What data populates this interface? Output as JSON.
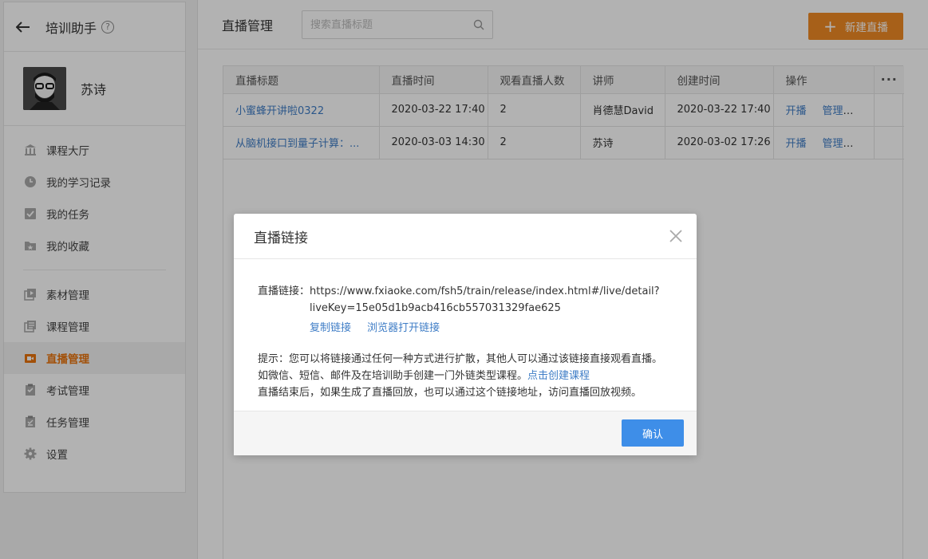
{
  "sidebar": {
    "title": "培训助手",
    "help_glyph": "?",
    "back_glyph": "←",
    "user_name": "苏诗",
    "nav_groups": [
      [
        {
          "label": "课程大厅",
          "icon": "bank-icon"
        },
        {
          "label": "我的学习记录",
          "icon": "clock-icon"
        },
        {
          "label": "我的任务",
          "icon": "checkbox-icon"
        },
        {
          "label": "我的收藏",
          "icon": "folder-star-icon"
        }
      ],
      [
        {
          "label": "素材管理",
          "icon": "media-icon"
        },
        {
          "label": "课程管理",
          "icon": "course-icon"
        },
        {
          "label": "直播管理",
          "icon": "live-camera-icon",
          "active": true
        },
        {
          "label": "考试管理",
          "icon": "exam-icon"
        },
        {
          "label": "任务管理",
          "icon": "task-icon"
        },
        {
          "label": "设置",
          "icon": "gear-icon"
        }
      ]
    ],
    "active_color": "#e8730c"
  },
  "main": {
    "title": "直播管理",
    "search_placeholder": "搜索直播标题",
    "new_button": "新建直播",
    "new_button_plus": "+",
    "table": {
      "headers": [
        "直播标题",
        "直播时间",
        "观看直播人数",
        "讲师",
        "创建时间",
        "操作",
        "···"
      ],
      "rows": [
        {
          "title": "小蜜蜂开讲啦0322",
          "time": "2020-03-22 17:40",
          "viewers": "2",
          "lecturer": "肖德慧David",
          "created": "2020-03-22 17:40",
          "op_start": "开播",
          "op_manage": "管理"
        },
        {
          "title": "从脑机接口到量子计算：...",
          "time": "2020-03-03 14:30",
          "viewers": "2",
          "lecturer": "苏诗",
          "created": "2020-03-02 17:26",
          "op_start": "开播",
          "op_manage": "管理"
        }
      ]
    }
  },
  "modal": {
    "title": "直播链接",
    "link_label": "直播链接：",
    "link_line1": "https://www.fxiaoke.com/fsh5/train/release/index.html#/live/detail?",
    "link_line2": "liveKey=15e05d1b9acb416cb557031329fae625",
    "copy_link": "复制链接",
    "open_in_browser": "浏览器打开链接",
    "tip_line1": "提示：您可以将链接通过任何一种方式进行扩散，其他人可以通过该链接直接观看直播。",
    "tip_line2_prefix": "如微信、短信、邮件及在培训助手创建一门外链类型课程。",
    "tip_line2_link": "点击创建课程",
    "tip_line3": "直播结束后，如果生成了直播回放，也可以通过这个链接地址，访问直播回放视频。",
    "confirm": "确认"
  },
  "colors": {
    "link": "#3f7dc6",
    "new_button": "#f08a24",
    "confirm_button": "#3e8ee8"
  }
}
